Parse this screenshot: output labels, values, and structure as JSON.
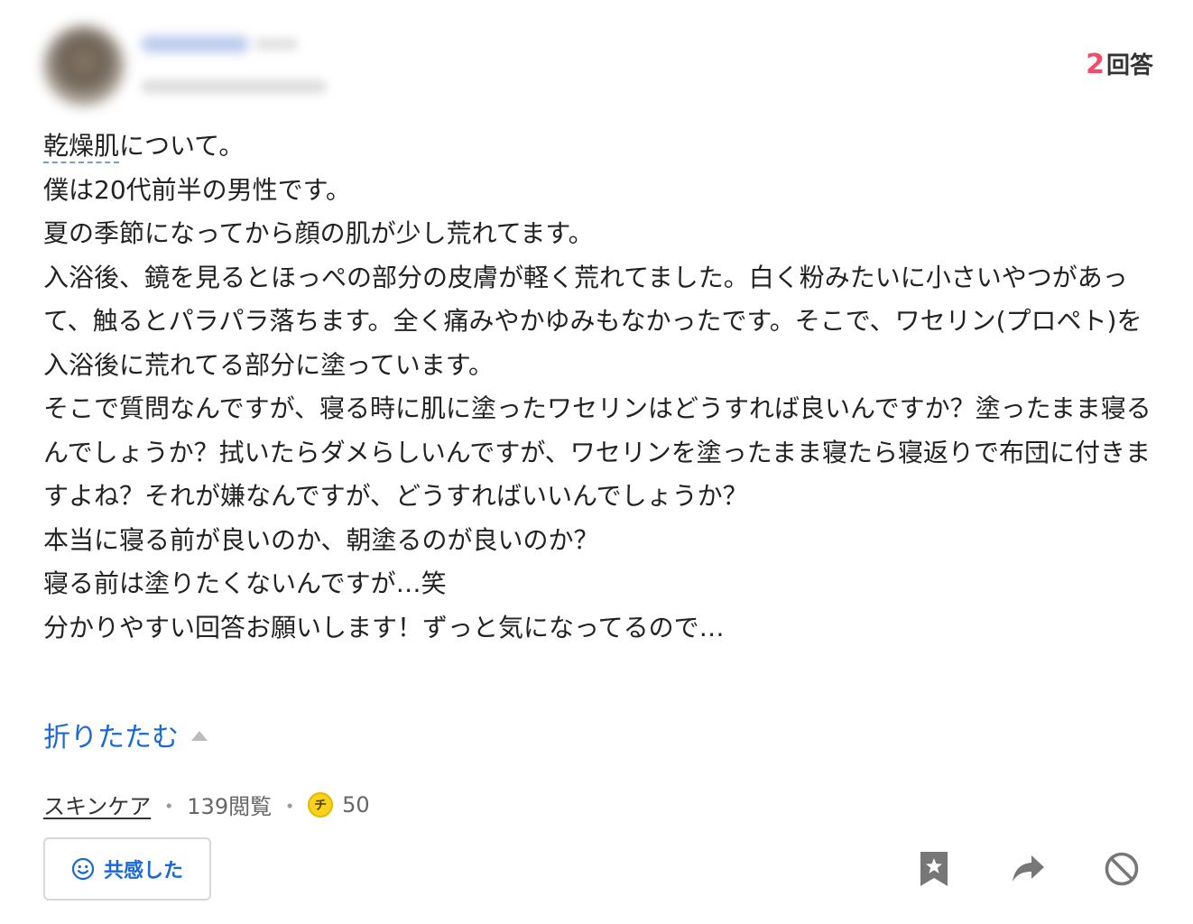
{
  "header": {
    "answer_count": "2",
    "answer_suffix": "回答"
  },
  "question": {
    "keyword": "乾燥肌",
    "first_line_rest": "について。",
    "lines": [
      "僕は20代前半の男性です。",
      "夏の季節になってから顔の肌が少し荒れてます。",
      "入浴後、鏡を見るとほっぺの部分の皮膚が軽く荒れてました。白く粉みたいに小さいやつがあって、触るとパラパラ落ちます。全く痛みやかゆみもなかったです。そこで、ワセリン(プロペト)を入浴後に荒れてる部分に塗っています。",
      "そこで質問なんですが、寝る時に肌に塗ったワセリンはどうすれば良いんですか？塗ったまま寝るんでしょうか？拭いたらダメらしいんですが、ワセリンを塗ったまま寝たら寝返りで布団に付きますよね？それが嫌なんですが、どうすればいいんでしょうか？",
      "本当に寝る前が良いのか、朝塗るのが良いのか？",
      "寝る前は塗りたくないんですが…笑",
      "分かりやすい回答お願いします！ずっと気になってるので…"
    ]
  },
  "collapse_label": "折りたたむ",
  "meta": {
    "category": "スキンケア",
    "separator": "・",
    "views": "139閲覧",
    "coin_glyph": "チ",
    "coins": "50"
  },
  "empathy_button": {
    "label": "共感した"
  },
  "colors": {
    "accent": "#1a68d6",
    "answer_count": "#f04d6a",
    "icon_gray": "#777777"
  },
  "icons": {
    "empathy": "smile-icon",
    "bookmark": "bookmark-star-icon",
    "share": "share-arrow-icon",
    "block": "block-icon"
  }
}
